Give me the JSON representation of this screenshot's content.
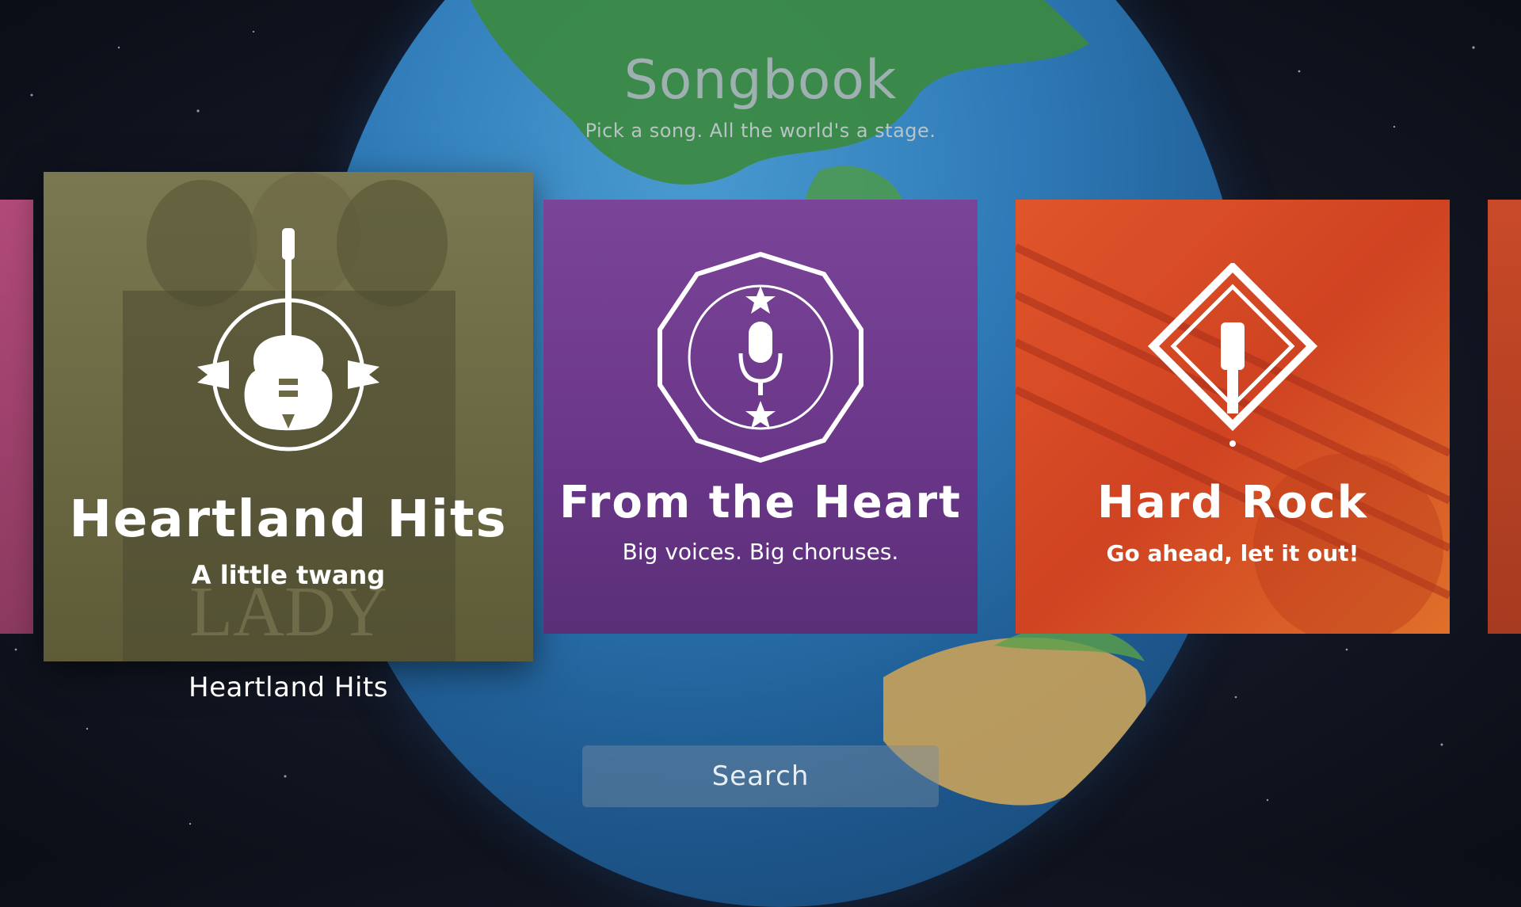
{
  "header": {
    "title": "Songbook",
    "subtitle": "Pick a song. All the world's a stage."
  },
  "cards": [
    {
      "title": "Heartland Hits",
      "subtitle": "A little twang",
      "icon": "guitar-emblem-icon",
      "color": "#6b6a44"
    },
    {
      "title": "From the Heart",
      "subtitle": "Big voices. Big choruses.",
      "icon": "microphone-badge-icon",
      "color": "#6d3a8c"
    },
    {
      "title": "Hard Rock",
      "subtitle": "Go ahead, let it out!",
      "icon": "guitar-diamond-icon",
      "color": "#d24a22"
    }
  ],
  "focused_caption": "Heartland Hits",
  "search": {
    "label": "Search"
  }
}
